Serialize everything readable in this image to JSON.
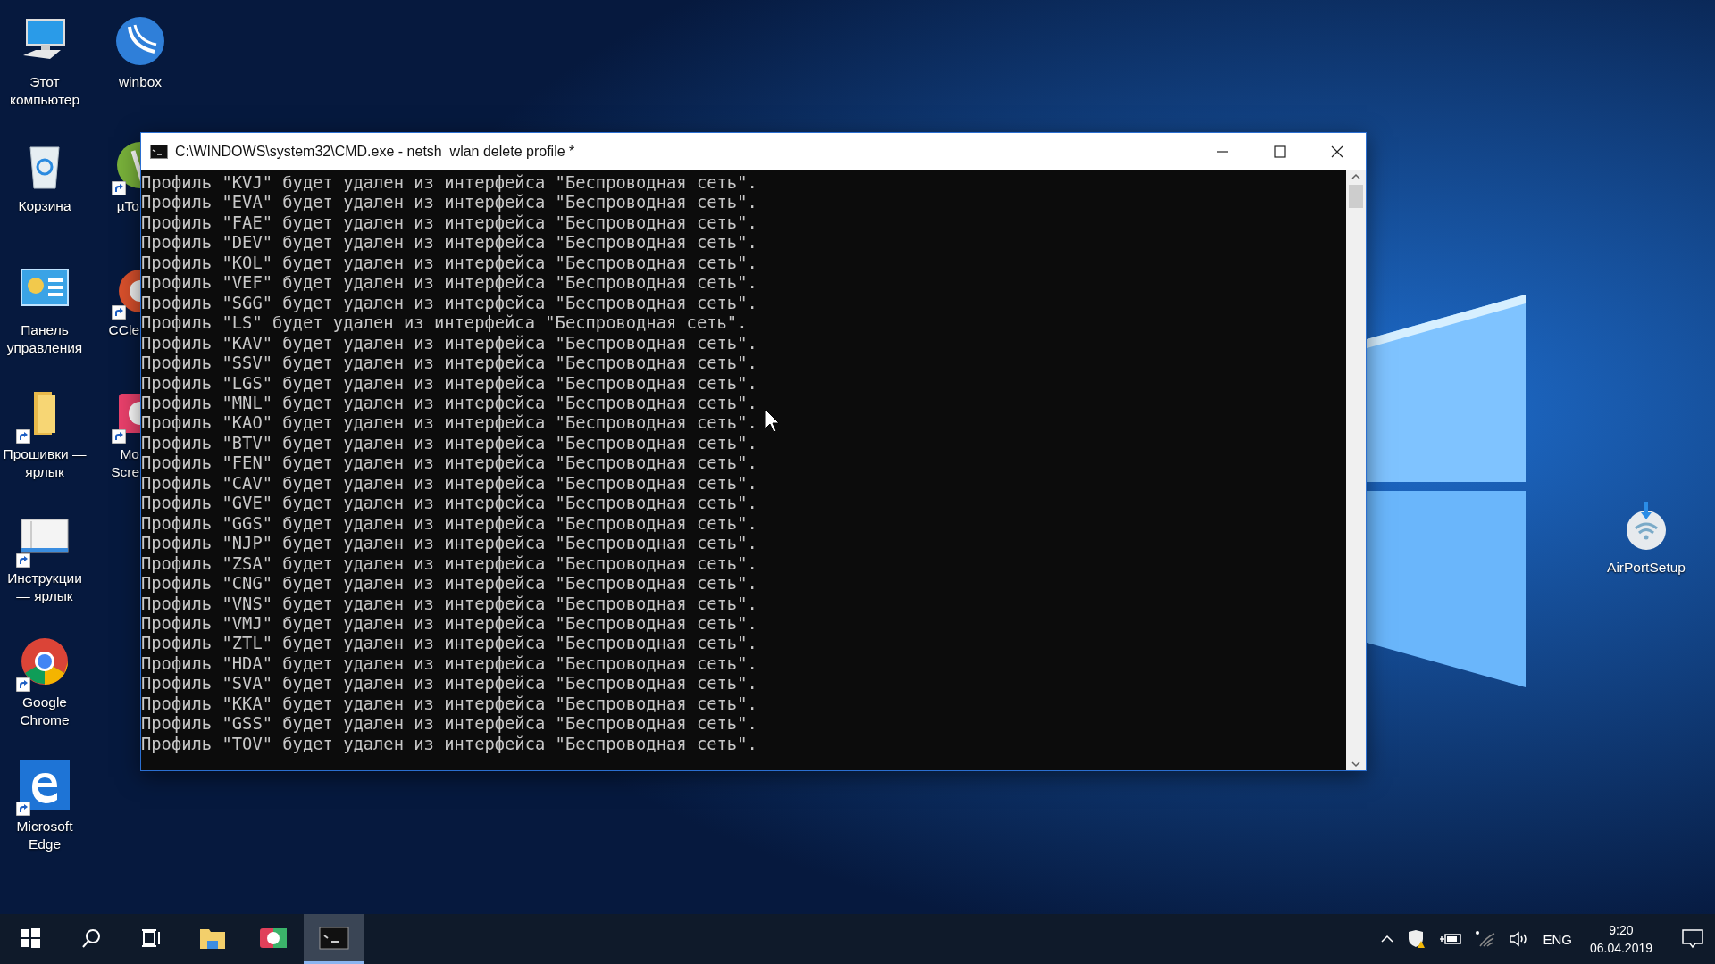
{
  "desktop_columns": [
    [
      {
        "label": "Этот компьютер",
        "kind": "computer",
        "shortcut": false
      },
      {
        "label": "Корзина",
        "kind": "recycle",
        "shortcut": false
      },
      {
        "label": "Панель управления",
        "kind": "control-panel",
        "shortcut": false
      },
      {
        "label": "Прошивки — ярлык",
        "kind": "folder",
        "shortcut": true
      },
      {
        "label": "Инструкции — ярлык",
        "kind": "window",
        "shortcut": true
      },
      {
        "label": "Google Chrome",
        "kind": "chrome",
        "shortcut": true
      },
      {
        "label": "Microsoft Edge",
        "kind": "edge",
        "shortcut": true
      }
    ],
    [
      {
        "label": "winbox",
        "kind": "winbox",
        "shortcut": false
      },
      {
        "label": "µTo",
        "kind": "utorrent",
        "shortcut": true
      },
      {
        "label": "CCle",
        "kind": "ccleaner",
        "shortcut": true
      },
      {
        "label": "Mo Scre",
        "kind": "recorder",
        "shortcut": true
      }
    ]
  ],
  "right_icon": {
    "label": "AirPortSetup",
    "kind": "airport"
  },
  "window": {
    "title": "C:\\WINDOWS\\system32\\CMD.exe - netsh  wlan delete profile *",
    "lines": [
      "Профиль \"KVJ\" будет удален из интерфейса \"Беспроводная сеть\".",
      "Профиль \"EVA\" будет удален из интерфейса \"Беспроводная сеть\".",
      "Профиль \"FAE\" будет удален из интерфейса \"Беспроводная сеть\".",
      "Профиль \"DEV\" будет удален из интерфейса \"Беспроводная сеть\".",
      "Профиль \"KOL\" будет удален из интерфейса \"Беспроводная сеть\".",
      "Профиль \"VEF\" будет удален из интерфейса \"Беспроводная сеть\".",
      "Профиль \"SGG\" будет удален из интерфейса \"Беспроводная сеть\".",
      "Профиль \"LS\" будет удален из интерфейса \"Беспроводная сеть\".",
      "Профиль \"KAV\" будет удален из интерфейса \"Беспроводная сеть\".",
      "Профиль \"SSV\" будет удален из интерфейса \"Беспроводная сеть\".",
      "Профиль \"LGS\" будет удален из интерфейса \"Беспроводная сеть\".",
      "Профиль \"MNL\" будет удален из интерфейса \"Беспроводная сеть\".",
      "Профиль \"KAO\" будет удален из интерфейса \"Беспроводная сеть\".",
      "Профиль \"BTV\" будет удален из интерфейса \"Беспроводная сеть\".",
      "Профиль \"FEN\" будет удален из интерфейса \"Беспроводная сеть\".",
      "Профиль \"CAV\" будет удален из интерфейса \"Беспроводная сеть\".",
      "Профиль \"GVE\" будет удален из интерфейса \"Беспроводная сеть\".",
      "Профиль \"GGS\" будет удален из интерфейса \"Беспроводная сеть\".",
      "Профиль \"NJP\" будет удален из интерфейса \"Беспроводная сеть\".",
      "Профиль \"ZSA\" будет удален из интерфейса \"Беспроводная сеть\".",
      "Профиль \"CNG\" будет удален из интерфейса \"Беспроводная сеть\".",
      "Профиль \"VNS\" будет удален из интерфейса \"Беспроводная сеть\".",
      "Профиль \"VMJ\" будет удален из интерфейса \"Беспроводная сеть\".",
      "Профиль \"ZTL\" будет удален из интерфейса \"Беспроводная сеть\".",
      "Профиль \"HDA\" будет удален из интерфейса \"Беспроводная сеть\".",
      "Профиль \"SVA\" будет удален из интерфейса \"Беспроводная сеть\".",
      "Профиль \"KKA\" будет удален из интерфейса \"Беспроводная сеть\".",
      "Профиль \"GSS\" будет удален из интерфейса \"Беспроводная сеть\".",
      "Профиль \"TOV\" будет удален из интерфейса \"Беспроводная сеть\"."
    ]
  },
  "taskbar": {
    "apps": [
      {
        "kind": "start",
        "active": false
      },
      {
        "kind": "search",
        "active": false
      },
      {
        "kind": "taskview",
        "active": false
      },
      {
        "kind": "explorer",
        "active": false
      },
      {
        "kind": "camera",
        "active": false
      },
      {
        "kind": "console",
        "active": true
      }
    ],
    "tray": {
      "language": "ENG",
      "time": "9:20",
      "date": "06.04.2019"
    }
  }
}
